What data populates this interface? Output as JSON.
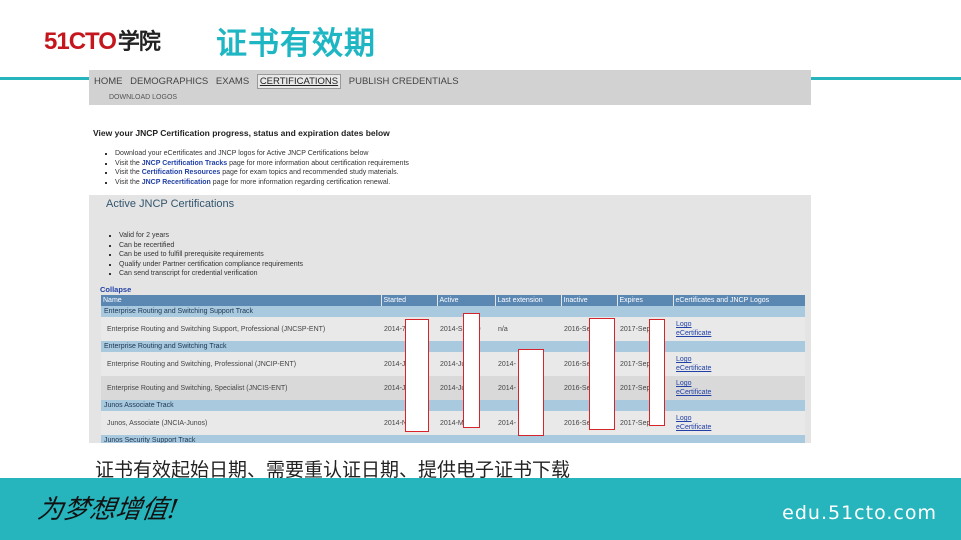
{
  "slide": {
    "logo_main": "51CTO",
    "logo_sub": "学院",
    "title": "证书有效期",
    "caption": "证书有效起始日期、需要重认证日期、提供电子证书下载",
    "slogan": "为梦想增值!",
    "site": "edu.51cto.com",
    "colors": {
      "accent": "#26b4bd",
      "title": "#1fb6c4",
      "logo": "#c4161c"
    }
  },
  "screenshot": {
    "nav": [
      "HOME",
      "DEMOGRAPHICS",
      "EXAMS",
      "CERTIFICATIONS",
      "PUBLISH CREDENTIALS"
    ],
    "nav_active": "CERTIFICATIONS",
    "subnav": "DOWNLOAD LOGOS",
    "intro": "View your JNCP Certification progress, status and expiration dates below",
    "bullets": {
      "b1": "Download your eCertificates and JNCP logos for Active JNCP Certifications below",
      "b2_pre": "Visit the ",
      "b2_link": "JNCP Certification Tracks",
      "b2_post": " page for more information about certification requirements",
      "b3_pre": "Visit the ",
      "b3_link": "Certification Resources",
      "b3_post": " page for exam topics and recommended study materials.",
      "b4_pre": "Visit the ",
      "b4_link": "JNCP Recertification",
      "b4_post": " page for more information regarding certification renewal."
    },
    "active_title": "Active JNCP Certifications",
    "active_notes": [
      "Valid for 2 years",
      "Can be recertified",
      "Can be used to fulfill prerequisite requirements",
      "Qualify under Partner certification compliance requirements",
      "Can send transcript for credential verification"
    ],
    "collapse": "Collapse",
    "columns": [
      "Name",
      "Started",
      "Active",
      "Last extension",
      "Inactive",
      "Expires",
      "eCertificates and JNCP Logos"
    ],
    "tracks": {
      "t1": "Enterprise Routing and Switching Support Track",
      "t2": "Enterprise Routing and Switching Track",
      "t3": "Junos Associate Track",
      "t4": "Junos Security Support Track"
    },
    "certs": [
      {
        "name": "Enterprise Routing and Switching Support, Professional (JNCSP-ENT)",
        "started": "2014-7",
        "active": "2014-S",
        "active_tail": "0",
        "last_ext": "n/a",
        "inactive": "2016-Se",
        "expires": "2017-Sep",
        "logo": "Logo",
        "ecert": "eCertificate"
      },
      {
        "name": "Enterprise Routing and Switching, Professional (JNCIP-ENT)",
        "started": "2014-J",
        "active": "2014-Ju",
        "active_tail": "2",
        "last_ext": "2014-",
        "inactive": "2016-Se",
        "expires": "2017-Sep",
        "logo": "Logo",
        "ecert": "eCertificate"
      },
      {
        "name": "Enterprise Routing and Switching, Specialist (JNCIS-ENT)",
        "started": "2014-J",
        "active": "2014-Ju",
        "active_tail": "4",
        "last_ext": "2014-",
        "inactive": "2016-Se",
        "expires": "2017-Sep",
        "logo": "Logo",
        "ecert": "eCertificate"
      },
      {
        "name": "Junos, Associate (JNCIA-Junos)",
        "started": "2014-N",
        "active": "2014-M",
        "active_tail": "8",
        "last_ext": "2014-",
        "inactive": "2016-Se",
        "expires": "2017-Sep",
        "logo": "Logo",
        "ecert": "eCertificate"
      }
    ]
  }
}
